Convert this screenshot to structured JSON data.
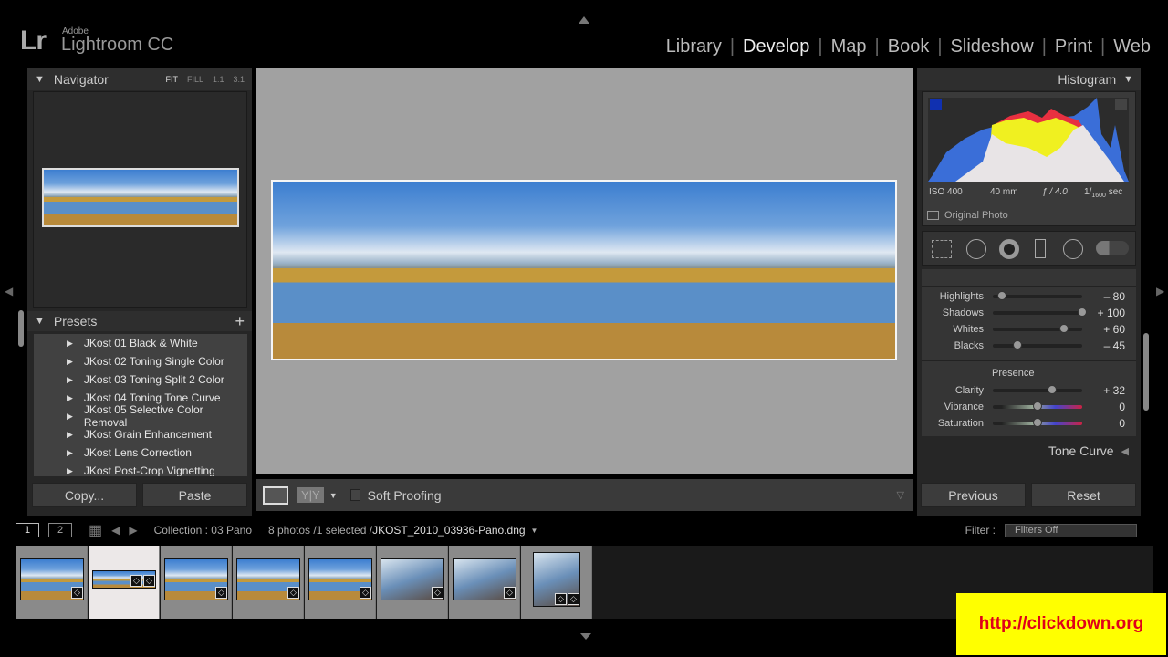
{
  "app": {
    "logo": "Lr",
    "vendor": "Adobe",
    "name": "Lightroom CC"
  },
  "modules": [
    {
      "label": "Library"
    },
    {
      "label": "Develop",
      "active": true
    },
    {
      "label": "Map"
    },
    {
      "label": "Book"
    },
    {
      "label": "Slideshow"
    },
    {
      "label": "Print"
    },
    {
      "label": "Web"
    }
  ],
  "navigator": {
    "title": "Navigator",
    "zoom": [
      "FIT",
      "FILL",
      "1:1",
      "3:1"
    ]
  },
  "presets": {
    "title": "Presets",
    "add": "+",
    "items": [
      "JKost 01 Black & White",
      "JKost 02 Toning Single Color",
      "JKost 03 Toning Split 2 Color",
      "JKost 04 Toning Tone Curve",
      "JKost 05 Selective Color Removal",
      "JKost Grain Enhancement",
      "JKost Lens Correction",
      "JKost Post-Crop Vignetting"
    ]
  },
  "left_buttons": {
    "copy": "Copy...",
    "paste": "Paste"
  },
  "toolbar": {
    "soft_proofing": "Soft Proofing",
    "compare": "Y|Y"
  },
  "histogram": {
    "title": "Histogram",
    "iso": "ISO 400",
    "focal": "40 mm",
    "aperture": "ƒ / 4.0",
    "shutter_num": "1/",
    "shutter_den": "1600",
    "shutter_unit": "sec",
    "original_photo": "Original Photo"
  },
  "basic": {
    "sliders": [
      {
        "label": "Highlights",
        "value": "– 80",
        "num": -80
      },
      {
        "label": "Shadows",
        "value": "+ 100",
        "num": 100
      },
      {
        "label": "Whites",
        "value": "+ 60",
        "num": 60
      },
      {
        "label": "Blacks",
        "value": "– 45",
        "num": -45
      }
    ],
    "presence_title": "Presence",
    "presence": [
      {
        "label": "Clarity",
        "value": "+ 32",
        "num": 32
      },
      {
        "label": "Vibrance",
        "value": "0",
        "num": 0,
        "colored": true
      },
      {
        "label": "Saturation",
        "value": "0",
        "num": 0,
        "colored": true
      }
    ]
  },
  "tone_curve": "Tone Curve",
  "right_buttons": {
    "previous": "Previous",
    "reset": "Reset"
  },
  "filmstrip": {
    "screen1": "1",
    "screen2": "2",
    "collection": "Collection : 03 Pano",
    "count": "8 photos /1 selected /",
    "filename": "JKOST_2010_03936-Pano.dng",
    "filter_label": "Filter :",
    "filter_value": "Filters Off",
    "selected_index": 1
  },
  "watermark": "http://clickdown.org"
}
